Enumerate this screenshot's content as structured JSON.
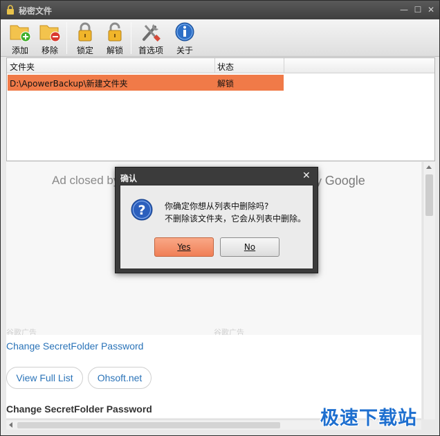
{
  "window": {
    "title": "秘密文件"
  },
  "toolbar": {
    "add": "添加",
    "remove": "移除",
    "lock": "锁定",
    "unlock": "解锁",
    "prefs": "首选项",
    "about": "关于"
  },
  "list": {
    "columns": [
      "文件夹",
      "状态"
    ],
    "rows": [
      {
        "folder": "D:\\ApowerBackup\\新建文件夹",
        "status": "解锁"
      }
    ]
  },
  "ad": {
    "left_text": "Ad closed by",
    "right_text": "by",
    "google": "Google",
    "tag_left": "谷歌广告",
    "tag_right": "谷歌广告"
  },
  "web": {
    "link": "Change SecretFolder Password",
    "pill_full_list": "View Full List",
    "pill_ohsoft": "Ohsoft.net",
    "heading": "Change SecretFolder Password"
  },
  "watermark": "极速下载站",
  "dialog": {
    "title": "确认",
    "close": "✕",
    "line1": "你确定你想从列表中删除吗?",
    "line2": "不删除该文件夹，它会从列表中删除。",
    "yes": "Yes",
    "no": "No"
  },
  "colors": {
    "selected_row": "#f07a48",
    "link": "#2a73b8",
    "watermark": "#1e6fcf"
  }
}
